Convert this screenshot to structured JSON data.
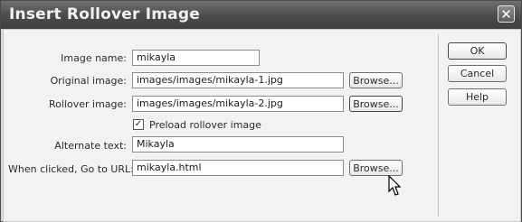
{
  "window": {
    "title": "Insert Rollover Image",
    "close_glyph": "✕"
  },
  "form": {
    "image_name": {
      "label": "Image name:",
      "value": "mikayla"
    },
    "original_image": {
      "label": "Original image:",
      "value": "images/images/mikayla-1.jpg",
      "button": "Browse..."
    },
    "rollover_image": {
      "label": "Rollover image:",
      "value": "images/images/mikayla-2.jpg",
      "button": "Browse..."
    },
    "preload": {
      "label": "Preload rollover image",
      "checked": true,
      "glyph": "✓"
    },
    "alternate_text": {
      "label": "Alternate text:",
      "value": "Mikayla"
    },
    "go_to_url": {
      "label": "When clicked, Go to URL:",
      "value": "mikayla.html",
      "button": "Browse..."
    }
  },
  "actions": {
    "ok": "OK",
    "cancel": "Cancel",
    "help": "Help"
  }
}
